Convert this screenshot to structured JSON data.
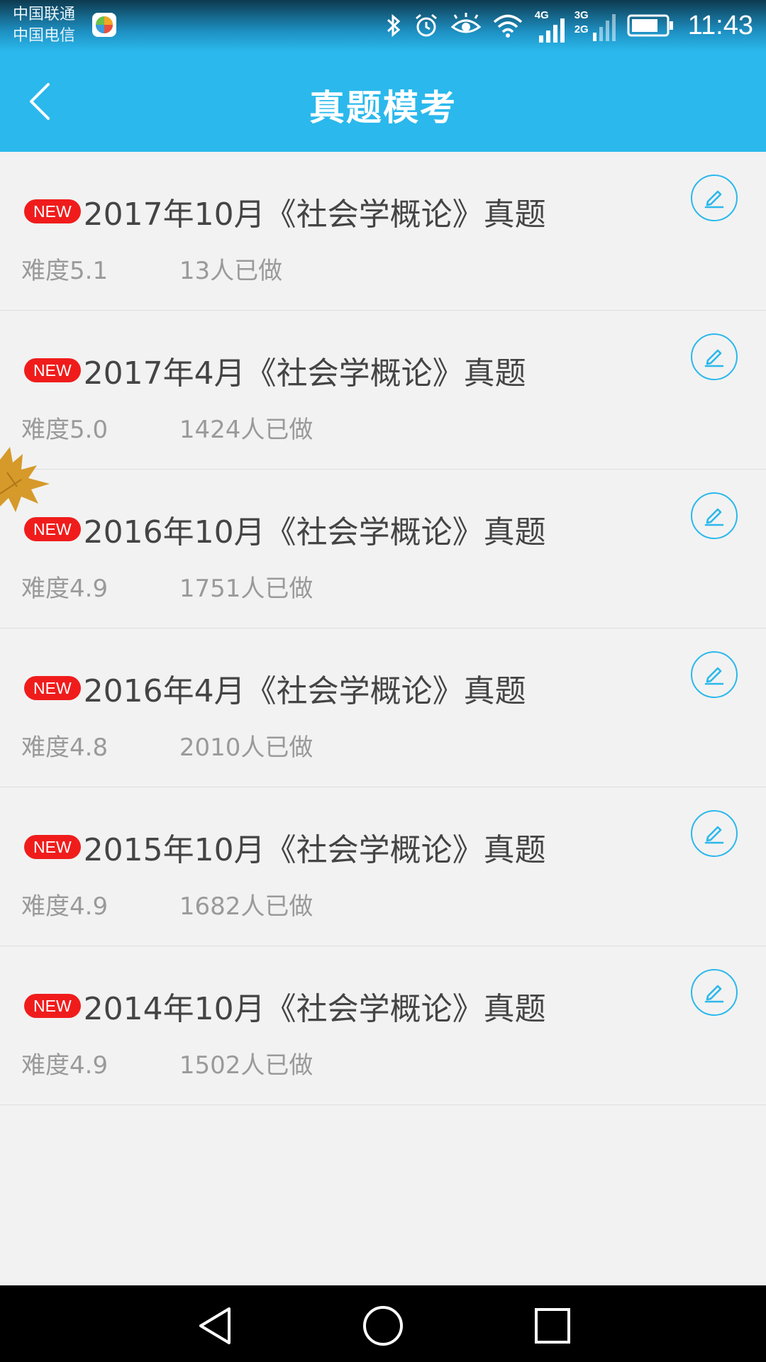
{
  "status_bar": {
    "carrier_1": "中国联通",
    "carrier_2": "中国电信",
    "net_1": "4G",
    "net_2a": "3G",
    "net_2b": "2G",
    "time": "11:43"
  },
  "header": {
    "title": "真题模考",
    "back_icon": "chevron-left-icon"
  },
  "colors": {
    "accent": "#2bb8ec",
    "badge": "#f01c1c",
    "title_text": "#444444",
    "meta_text": "#9a9a9a"
  },
  "exams": [
    {
      "badge": "NEW",
      "title": "2017年10月《社会学概论》真题",
      "difficulty": "难度5.1",
      "done": "13人已做"
    },
    {
      "badge": "NEW",
      "title": "2017年4月《社会学概论》真题",
      "difficulty": "难度5.0",
      "done": "1424人已做"
    },
    {
      "badge": "NEW",
      "title": "2016年10月《社会学概论》真题",
      "difficulty": "难度4.9",
      "done": "1751人已做"
    },
    {
      "badge": "NEW",
      "title": "2016年4月《社会学概论》真题",
      "difficulty": "难度4.8",
      "done": "2010人已做"
    },
    {
      "badge": "NEW",
      "title": "2015年10月《社会学概论》真题",
      "difficulty": "难度4.9",
      "done": "1682人已做"
    },
    {
      "badge": "NEW",
      "title": "2014年10月《社会学概论》真题",
      "difficulty": "难度4.9",
      "done": "1502人已做"
    }
  ],
  "nav": {
    "back_icon": "triangle-back-icon",
    "home_icon": "circle-home-icon",
    "recents_icon": "square-recents-icon"
  }
}
